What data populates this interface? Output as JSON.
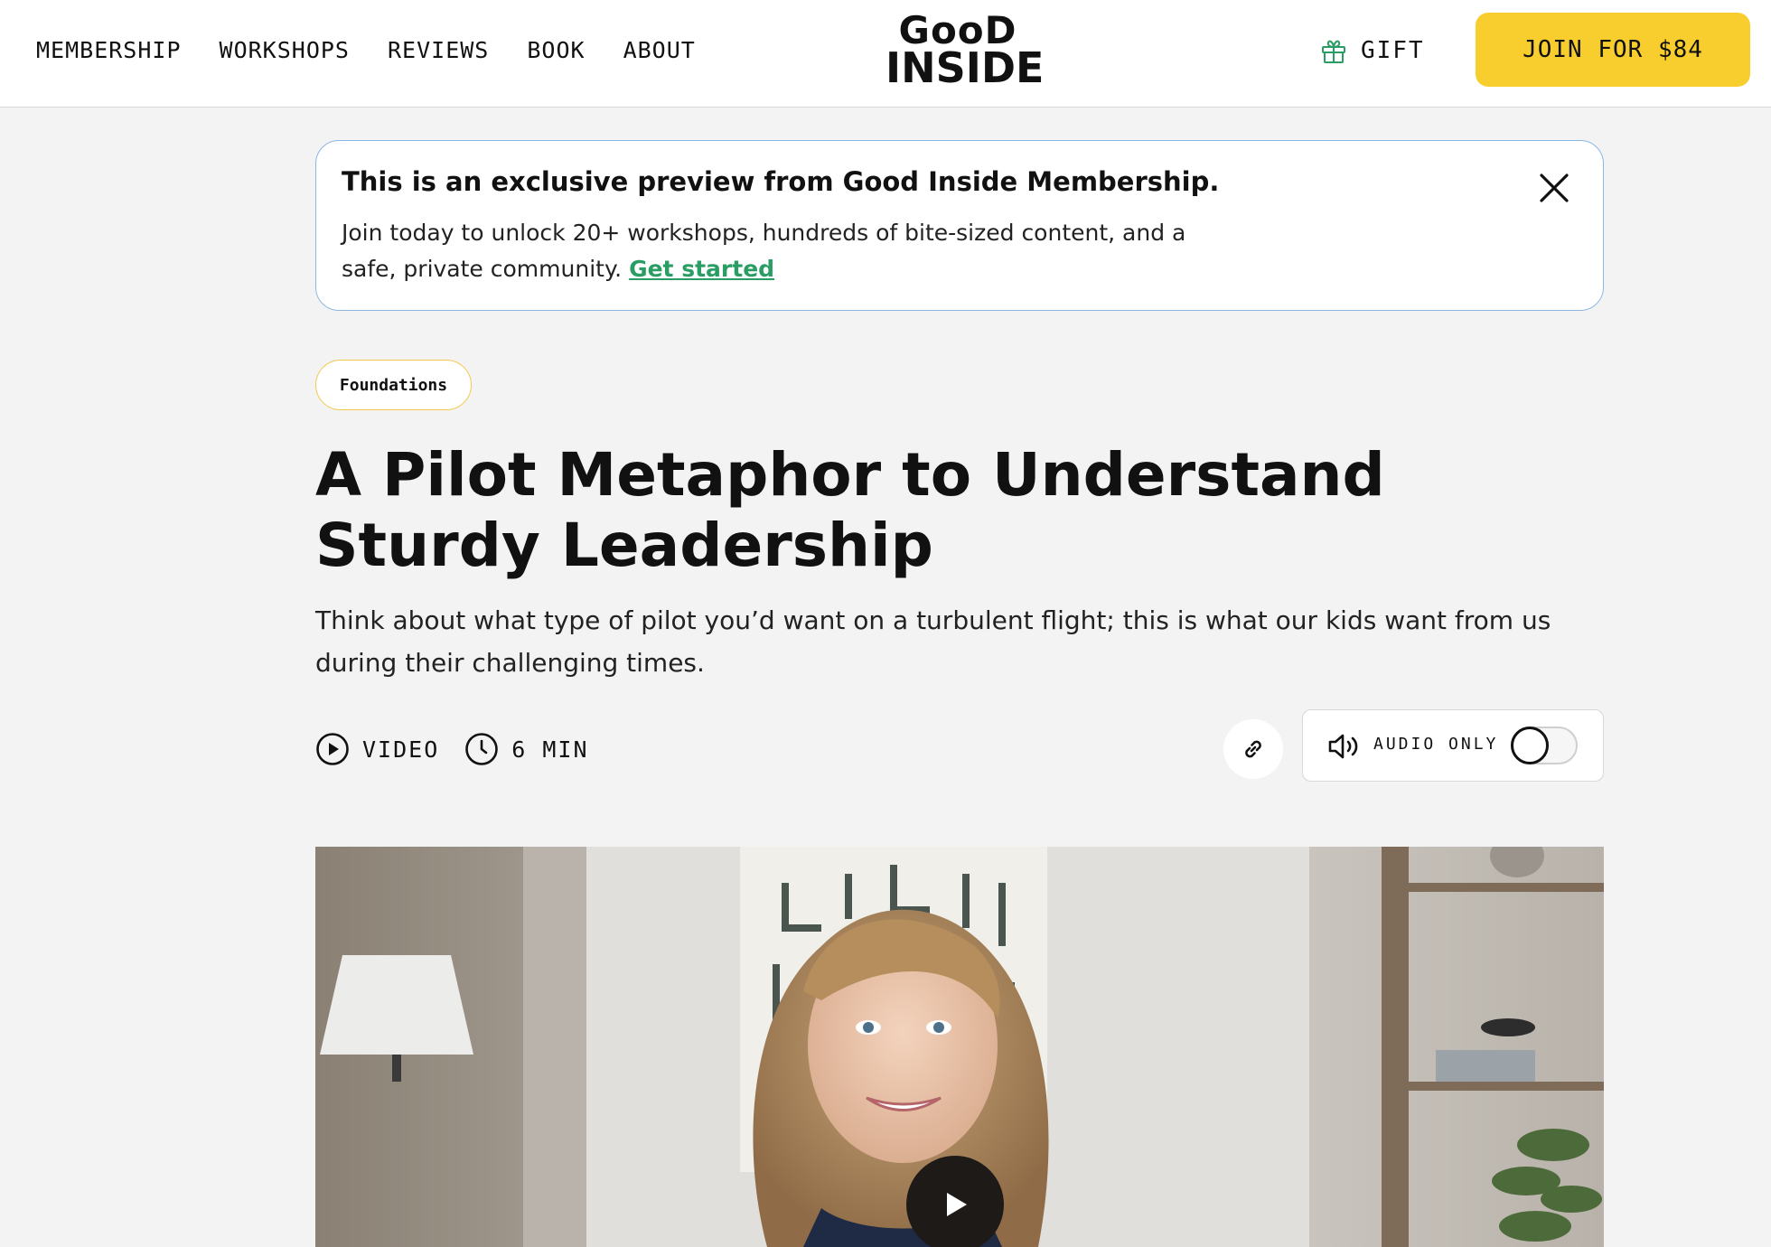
{
  "header": {
    "nav": [
      "MEMBERSHIP",
      "WORKSHOPS",
      "REVIEWS",
      "BOOK",
      "ABOUT"
    ],
    "logo_line1": "GooD",
    "logo_line2": "INSIDE",
    "gift_label": "GIFT",
    "join_label": "JOIN FOR $84"
  },
  "banner": {
    "title": "This is an exclusive preview from Good Inside Membership.",
    "body": "Join today to unlock 20+ workshops, hundreds of bite-sized content, and a safe, private community.",
    "cta": "Get started"
  },
  "article": {
    "tag": "Foundations",
    "title": "A Pilot Metaphor to Understand Sturdy Leadership",
    "subtitle": "Think about what type of pilot you’d want on a turbulent flight; this is what our kids want from us during their challenging times.",
    "media_type": "VIDEO",
    "duration": "6 MIN",
    "audio_only_label": "AUDIO ONLY",
    "audio_only_on": false
  },
  "colors": {
    "accent_yellow": "#f8ce2f",
    "link_green": "#2a9d64",
    "banner_border": "#8cb6e3",
    "page_bg": "#f3f3f3"
  },
  "icons": [
    "gift-icon",
    "close-icon",
    "play-circle-icon",
    "clock-icon",
    "link-icon",
    "speaker-icon",
    "play-icon"
  ]
}
